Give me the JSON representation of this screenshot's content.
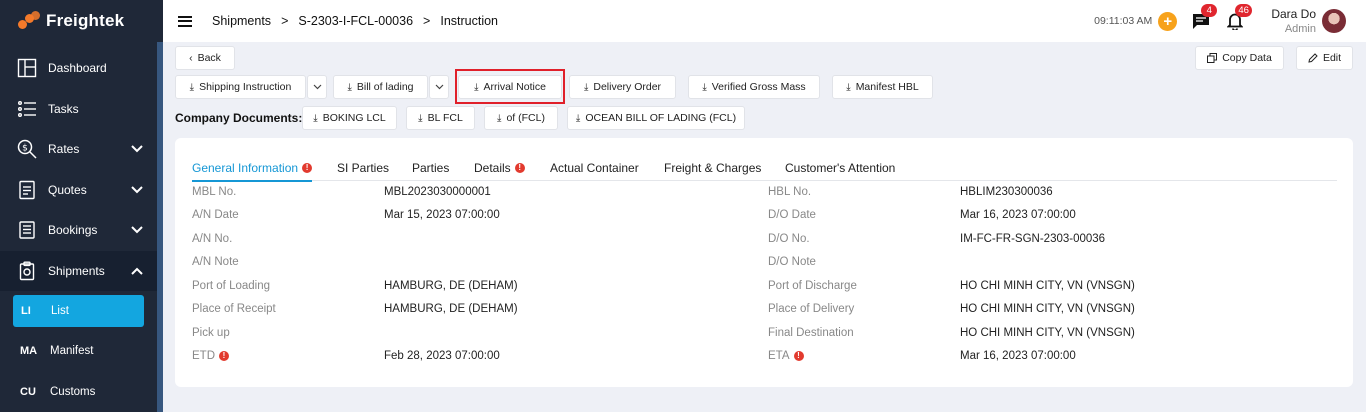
{
  "brand": {
    "name": "Freightek",
    "color": "#f47a2a"
  },
  "sidebar": {
    "items": [
      {
        "label": "Dashboard",
        "icon": "dashboard-icon"
      },
      {
        "label": "Tasks",
        "icon": "tasks-icon"
      },
      {
        "label": "Rates",
        "icon": "rates-icon"
      },
      {
        "label": "Quotes",
        "icon": "quotes-icon"
      },
      {
        "label": "Bookings",
        "icon": "bookings-icon"
      },
      {
        "label": "Shipments",
        "icon": "shipments-icon"
      }
    ],
    "sub_items": [
      {
        "abbr": "LI",
        "label": "List"
      },
      {
        "abbr": "MA",
        "label": "Manifest"
      },
      {
        "abbr": "CU",
        "label": "Customs"
      }
    ],
    "accent": "#13a6e0"
  },
  "header": {
    "breadcrumb": [
      "Shipments",
      "S-2303-I-FCL-00036",
      "Instruction"
    ],
    "separator": ">",
    "time": "09:11:03 AM",
    "plus": "+",
    "messages_count": "4",
    "notifications_count": "46",
    "user_name": "Dara Do",
    "user_role": "Admin"
  },
  "toolbar": {
    "back": "Back",
    "copy_data": "Copy Data",
    "edit": "Edit",
    "documents": [
      "Shipping Instruction",
      "Bill of lading",
      "Arrival Notice",
      "Delivery Order",
      "Verified Gross Mass",
      "Manifest HBL"
    ],
    "company_label": "Company Documents:",
    "company_documents": [
      "BOKING LCL",
      "BL FCL",
      "of (FCL)",
      "OCEAN BILL OF LADING (FCL)"
    ]
  },
  "tabs": [
    "General Information",
    "SI Parties",
    "Parties",
    "Details",
    "Actual Container",
    "Freight & Charges",
    "Customer's Attention"
  ],
  "general_info": {
    "left": [
      {
        "label": "MBL No.",
        "value": "MBL2023030000001"
      },
      {
        "label": "A/N Date",
        "value": "Mar 15, 2023 07:00:00"
      },
      {
        "label": "A/N No.",
        "value": ""
      },
      {
        "label": "A/N Note",
        "value": ""
      },
      {
        "label": "Port of Loading",
        "value": "HAMBURG, DE (DEHAM)"
      },
      {
        "label": "Place of Receipt",
        "value": "HAMBURG, DE (DEHAM)"
      },
      {
        "label": "Pick up",
        "value": ""
      },
      {
        "label": "ETD",
        "value": "Feb 28, 2023 07:00:00"
      }
    ],
    "right": [
      {
        "label": "HBL No.",
        "value": "HBLIM230300036"
      },
      {
        "label": "D/O Date",
        "value": "Mar 16, 2023 07:00:00"
      },
      {
        "label": "D/O No.",
        "value": "IM-FC-FR-SGN-2303-00036"
      },
      {
        "label": "D/O Note",
        "value": ""
      },
      {
        "label": "Port of Discharge",
        "value": "HO CHI MINH CITY, VN (VNSGN)"
      },
      {
        "label": "Place of Delivery",
        "value": "HO CHI MINH CITY, VN (VNSGN)"
      },
      {
        "label": "Final Destination",
        "value": "HO CHI MINH CITY, VN (VNSGN)"
      },
      {
        "label": "ETA",
        "value": "Mar 16, 2023 07:00:00"
      }
    ]
  },
  "colors": {
    "sidebar_bg": "#1f2838",
    "tab_active": "#1597d5",
    "badge": "#e0262e",
    "highlight": "#e0202a"
  }
}
